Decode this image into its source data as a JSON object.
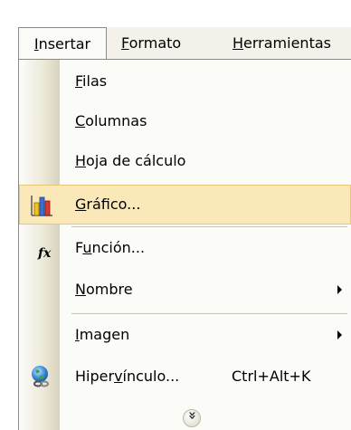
{
  "menubar": {
    "insertar": {
      "hot": "I",
      "rest": "nsertar"
    },
    "formato": {
      "hot": "F",
      "rest": "ormato"
    },
    "herramientas": {
      "hot": "H",
      "rest": "erramientas"
    }
  },
  "menu": {
    "filas": {
      "hot": "F",
      "rest": "ilas"
    },
    "columnas": {
      "hot": "C",
      "rest": "olumnas"
    },
    "hoja": {
      "hot": "H",
      "rest": "oja de cálculo"
    },
    "grafico": {
      "hot": "G",
      "rest": "ráfico..."
    },
    "funcion": {
      "pre": "F",
      "hot": "u",
      "rest": "nción..."
    },
    "nombre": {
      "hot": "N",
      "rest": "ombre"
    },
    "imagen": {
      "hot": "I",
      "rest": "magen"
    },
    "hipervinculo": {
      "pre": "Hiper",
      "hot": "v",
      "rest": "ínculo...",
      "shortcut": "Ctrl+Alt+K"
    },
    "fx_glyph": "fx",
    "expander_glyph": "»"
  },
  "colors": {
    "highlight": "#fbe8b8",
    "highlight_border": "#e9c676",
    "menubar_bg": "#f3f1ea"
  }
}
